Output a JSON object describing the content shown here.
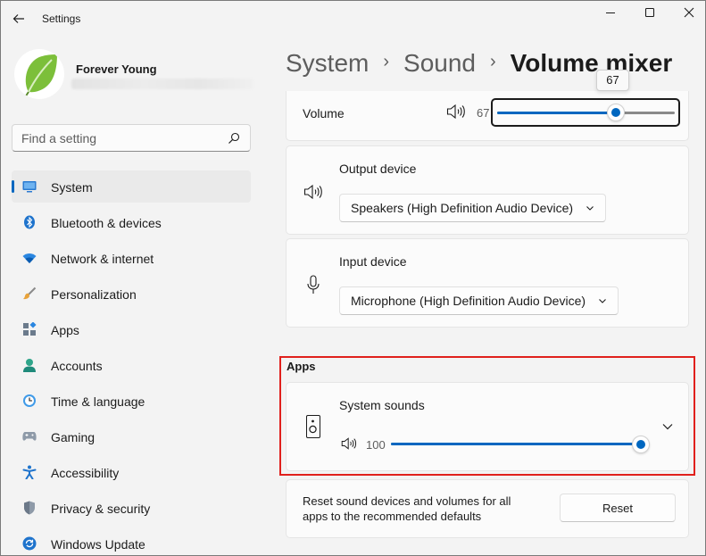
{
  "window": {
    "title": "Settings",
    "controls": {
      "minimize": "—",
      "maximize": "☐",
      "close": "✕"
    }
  },
  "profile": {
    "name": "Forever Young"
  },
  "search": {
    "placeholder": "Find a setting"
  },
  "nav": {
    "items": [
      {
        "label": "System",
        "icon": "system-icon",
        "selected": true
      },
      {
        "label": "Bluetooth & devices",
        "icon": "bluetooth-icon"
      },
      {
        "label": "Network & internet",
        "icon": "wifi-icon"
      },
      {
        "label": "Personalization",
        "icon": "brush-icon"
      },
      {
        "label": "Apps",
        "icon": "apps-icon"
      },
      {
        "label": "Accounts",
        "icon": "accounts-icon"
      },
      {
        "label": "Time & language",
        "icon": "time-language-icon"
      },
      {
        "label": "Gaming",
        "icon": "gaming-icon"
      },
      {
        "label": "Accessibility",
        "icon": "accessibility-icon"
      },
      {
        "label": "Privacy & security",
        "icon": "shield-icon"
      },
      {
        "label": "Windows Update",
        "icon": "update-icon"
      }
    ]
  },
  "breadcrumb": {
    "items": [
      "System",
      "Sound",
      "Volume mixer"
    ],
    "separator": "›"
  },
  "volume": {
    "label": "Volume",
    "value": "67",
    "tooltip": "67",
    "level_percent": 67
  },
  "output": {
    "title": "Output device",
    "selected": "Speakers (High Definition Audio Device)"
  },
  "input": {
    "title": "Input device",
    "selected": "Microphone (High Definition Audio Device)"
  },
  "apps": {
    "heading": "Apps",
    "items": [
      {
        "name": "System sounds",
        "value": "100",
        "level_percent": 100
      }
    ]
  },
  "reset": {
    "text": "Reset sound devices and volumes for all apps to the recommended defaults",
    "button": "Reset"
  },
  "colors": {
    "accent": "#0067c0",
    "highlight": "#e0201c"
  }
}
